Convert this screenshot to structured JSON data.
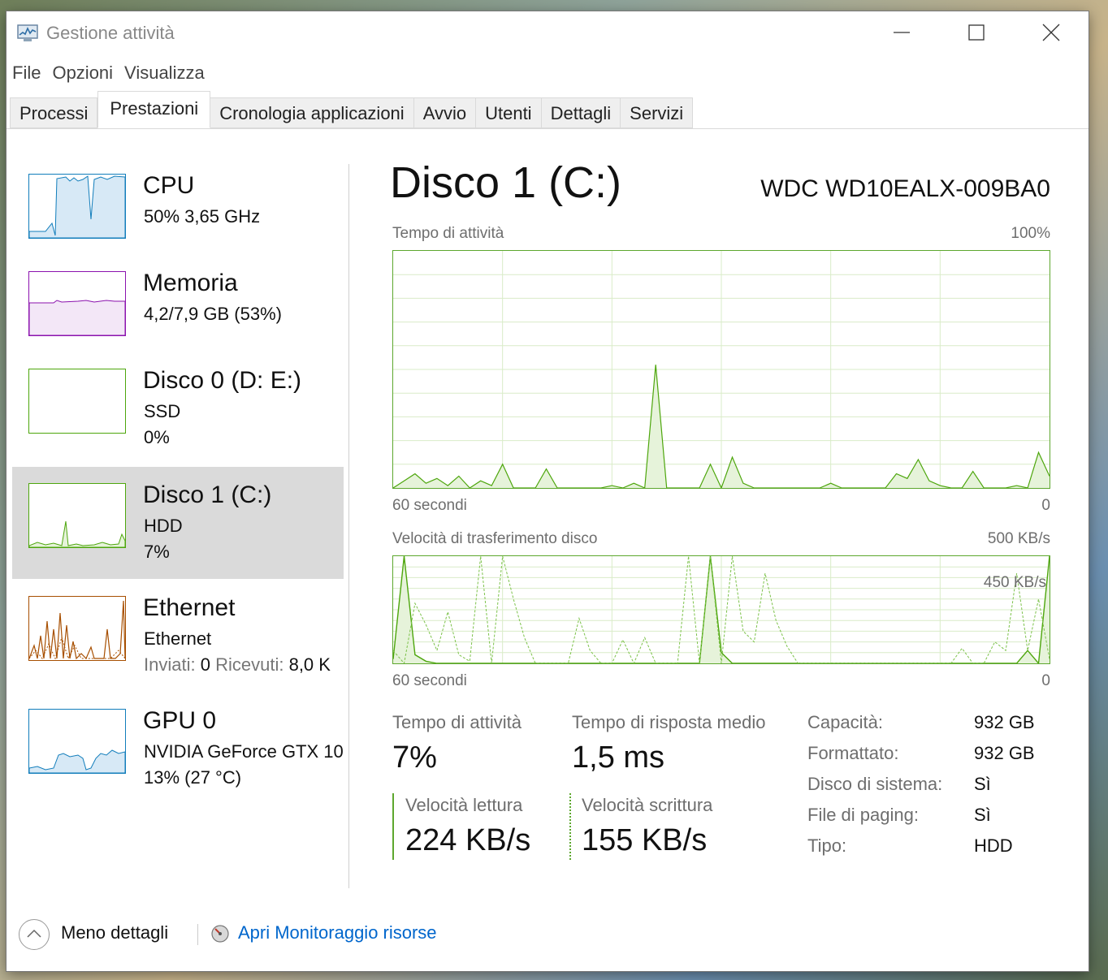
{
  "window": {
    "title": "Gestione attività",
    "menu": [
      "File",
      "Opzioni",
      "Visualizza"
    ],
    "tabs": [
      "Processi",
      "Prestazioni",
      "Cronologia applicazioni",
      "Avvio",
      "Utenti",
      "Dettagli",
      "Servizi"
    ],
    "active_tab": "Prestazioni"
  },
  "sidebar": {
    "items": [
      {
        "title": "CPU",
        "line1": "50%  3,65 GHz",
        "color": "#117dbb"
      },
      {
        "title": "Memoria",
        "line1": "4,2/7,9 GB (53%)",
        "color": "#8b12ae"
      },
      {
        "title": "Disco 0 (D: E:)",
        "line1": "SSD",
        "line2": "0%",
        "color": "#4da60c"
      },
      {
        "title": "Disco 1 (C:)",
        "line1": "HDD",
        "line2": "7%",
        "color": "#4da60c",
        "selected": true
      },
      {
        "title": "Ethernet",
        "line1": "Ethernet",
        "sent_label": "Inviati:",
        "sent_value": "0",
        "recv_label": "Ricevuti:",
        "recv_value": "8,0 K",
        "color": "#a74f01"
      },
      {
        "title": "GPU 0",
        "line1": "NVIDIA GeForce GTX 10",
        "line2": "13%  (27 °C)",
        "color": "#117dbb"
      }
    ]
  },
  "main": {
    "title": "Disco 1 (C:)",
    "model": "WDC WD10EALX-009BA0",
    "graph1": {
      "label": "Tempo di attività",
      "max": "100%",
      "time": "60 secondi",
      "zero": "0"
    },
    "graph2": {
      "label": "Velocità di trasferimento disco",
      "max": "500 KB/s",
      "inner_label": "450 KB/s",
      "time": "60 secondi",
      "zero": "0"
    },
    "stats": {
      "active_label": "Tempo di attività",
      "active_value": "7%",
      "response_label": "Tempo di risposta medio",
      "response_value": "1,5 ms",
      "read_label": "Velocità lettura",
      "read_value": "224 KB/s",
      "write_label": "Velocità scrittura",
      "write_value": "155 KB/s"
    },
    "properties": [
      {
        "label": "Capacità:",
        "value": "932 GB"
      },
      {
        "label": "Formattato:",
        "value": "932 GB"
      },
      {
        "label": "Disco di sistema:",
        "value": "Sì"
      },
      {
        "label": "File di paging:",
        "value": "Sì"
      },
      {
        "label": "Tipo:",
        "value": "HDD"
      }
    ]
  },
  "footer": {
    "less_details": "Meno dettagli",
    "resource_monitor": "Apri Monitoraggio risorse"
  },
  "colors": {
    "disk": "#4da60c",
    "link": "#0066cc"
  },
  "chart_data": [
    {
      "type": "area",
      "title": "Tempo di attività",
      "xlabel": "60 secondi",
      "ylim": [
        0,
        100
      ],
      "x": [
        -60,
        -59,
        -58,
        -57,
        -56,
        -55,
        -54,
        -53,
        -52,
        -51,
        -50,
        -49,
        -48,
        -47,
        -46,
        -45,
        -44,
        -43,
        -42,
        -41,
        -40,
        -39,
        -38,
        -37,
        -36,
        -35,
        -34,
        -33,
        -32,
        -31,
        -30,
        -29,
        -28,
        -27,
        -26,
        -25,
        -24,
        -23,
        -22,
        -21,
        -20,
        -19,
        -18,
        -17,
        -16,
        -15,
        -14,
        -13,
        -12,
        -11,
        -10,
        -9,
        -8,
        -7,
        -6,
        -5,
        -4,
        -3,
        -2,
        -1,
        0
      ],
      "series": [
        {
          "values": [
            0,
            3,
            6,
            2,
            4,
            1,
            5,
            0,
            3,
            1,
            10,
            0,
            0,
            0,
            8,
            0,
            0,
            0,
            0,
            0,
            1,
            0,
            2,
            0,
            52,
            0,
            0,
            0,
            0,
            10,
            0,
            13,
            2,
            0,
            0,
            0,
            0,
            0,
            0,
            0,
            2,
            0,
            0,
            0,
            0,
            0,
            6,
            4,
            12,
            3,
            1,
            0,
            0,
            7,
            0,
            0,
            0,
            1,
            0,
            15,
            5
          ]
        }
      ]
    },
    {
      "type": "line",
      "title": "Velocità di trasferimento disco",
      "xlabel": "60 secondi",
      "ylim": [
        0,
        500
      ],
      "series": [
        {
          "values": [
            20,
            500,
            40,
            10,
            0,
            0,
            0,
            0,
            0,
            0,
            0,
            0,
            0,
            0,
            0,
            0,
            0,
            0,
            0,
            0,
            0,
            0,
            0,
            0,
            0,
            0,
            0,
            0,
            0,
            500,
            50,
            0,
            0,
            0,
            0,
            0,
            0,
            0,
            0,
            0,
            0,
            0,
            0,
            0,
            0,
            0,
            0,
            0,
            0,
            0,
            0,
            0,
            0,
            0,
            0,
            0,
            0,
            0,
            60,
            0,
            500
          ]
        },
        {
          "values": [
            60,
            0,
            280,
            180,
            60,
            240,
            40,
            10,
            500,
            0,
            500,
            300,
            120,
            0,
            0,
            0,
            0,
            210,
            60,
            0,
            0,
            110,
            0,
            120,
            0,
            0,
            0,
            500,
            0,
            500,
            0,
            500,
            150,
            100,
            420,
            200,
            80,
            0,
            0,
            0,
            0,
            0,
            0,
            0,
            0,
            0,
            0,
            0,
            0,
            0,
            0,
            0,
            70,
            0,
            0,
            100,
            60,
            420,
            60,
            300,
            20
          ]
        }
      ]
    }
  ]
}
